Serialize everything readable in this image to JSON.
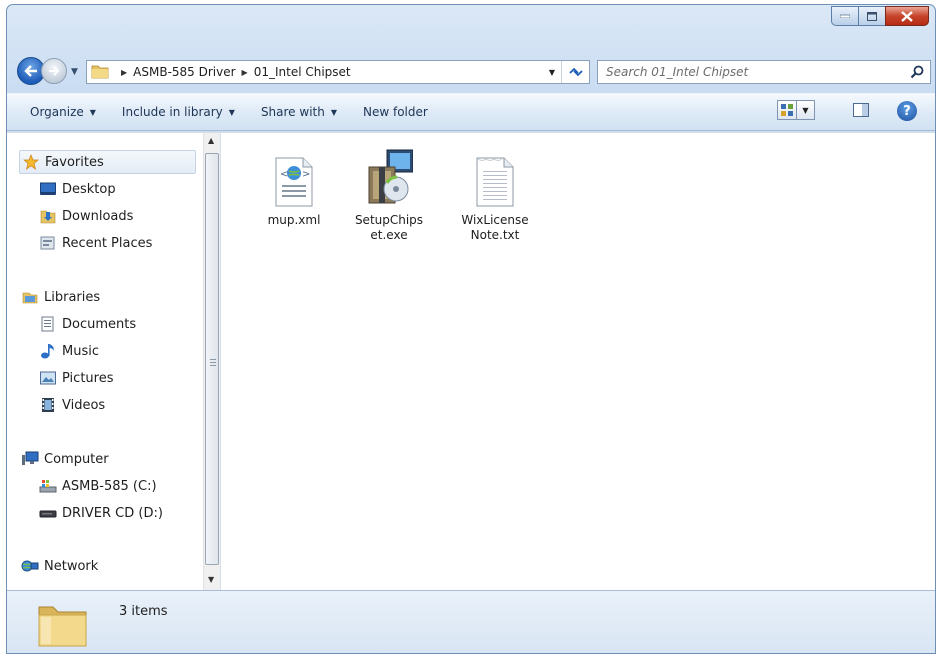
{
  "window": {
    "caption_buttons": [
      "minimize",
      "maximize",
      "close"
    ]
  },
  "address_bar": {
    "breadcrumbs": [
      "ASMB-585 Driver",
      "01_Intel Chipset"
    ]
  },
  "search": {
    "placeholder": "Search 01_Intel Chipset"
  },
  "toolbar": {
    "organize": "Organize",
    "include_in_library": "Include in library",
    "share_with": "Share with",
    "new_folder": "New folder"
  },
  "navigation": {
    "favorites": {
      "label": "Favorites",
      "items": [
        "Desktop",
        "Downloads",
        "Recent Places"
      ]
    },
    "libraries": {
      "label": "Libraries",
      "items": [
        "Documents",
        "Music",
        "Pictures",
        "Videos"
      ]
    },
    "computer": {
      "label": "Computer",
      "items": [
        "ASMB-585 (C:)",
        "DRIVER CD (D:)"
      ]
    },
    "network": {
      "label": "Network"
    }
  },
  "files": [
    {
      "name": "mup.xml",
      "icon": "xml-file-icon"
    },
    {
      "name": "SetupChipset.exe",
      "icon": "setup-exe-icon"
    },
    {
      "name": "WixLicenseNote.txt",
      "icon": "text-file-icon"
    }
  ],
  "file_labels": {
    "mup": "mup.xml",
    "setup_line1": "SetupChips",
    "setup_line2": "et.exe",
    "wix_line1": "WixLicense",
    "wix_line2": "Note.txt"
  },
  "status": {
    "item_count": "3 items"
  },
  "colors": {
    "close_button": "#c7442b",
    "back_button": "#1d5cb8",
    "chrome": "#c9dcf2"
  }
}
